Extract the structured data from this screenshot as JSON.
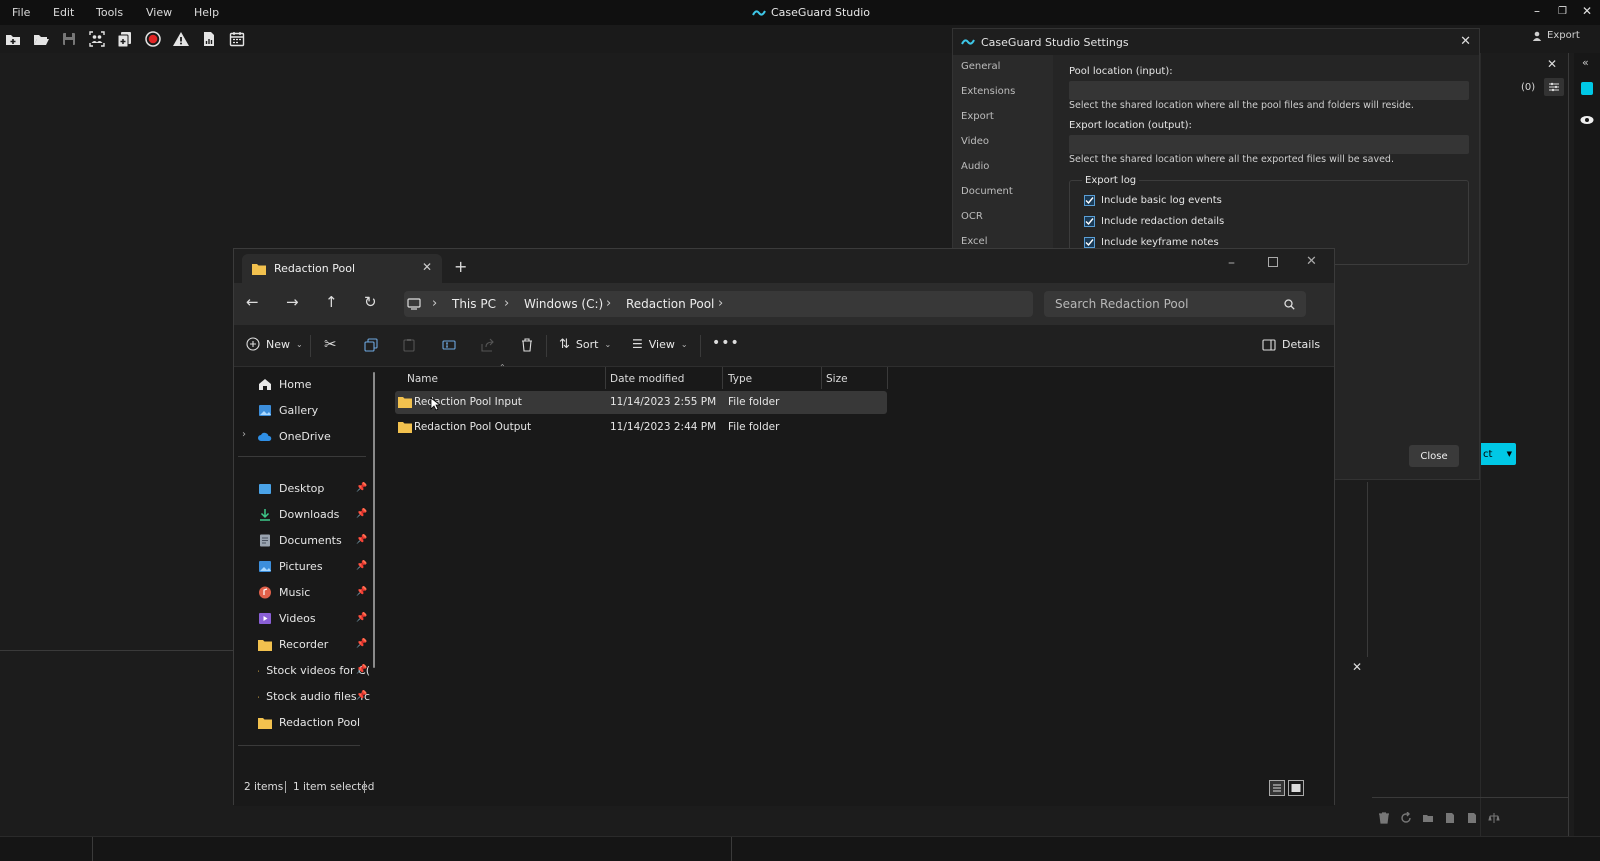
{
  "app": {
    "title": "CaseGuard Studio",
    "menu": [
      "File",
      "Edit",
      "Tools",
      "View",
      "Help"
    ],
    "export_label": "Export",
    "count_badge": "(0)",
    "close_icon_glyph": "✕",
    "partial_button_text": "ct",
    "panel_close_glyph": "✕"
  },
  "settings": {
    "title": "CaseGuard Studio Settings",
    "nav": [
      "General",
      "Extensions",
      "Export",
      "Video",
      "Audio",
      "Document",
      "OCR",
      "Excel"
    ],
    "pool_input_label": "Pool location (input):",
    "pool_input_value": "",
    "pool_input_desc": "Select the shared location where all the pool files and folders will reside.",
    "export_output_label": "Export location (output):",
    "export_output_value": "",
    "export_output_desc": "Select the shared location where all the exported files will be saved.",
    "export_log_legend": "Export log",
    "checkboxes": [
      {
        "label": "Include basic log events",
        "checked": true
      },
      {
        "label": "Include redaction details",
        "checked": true
      },
      {
        "label": "Include keyframe notes",
        "checked": true
      }
    ],
    "close_button": "Close"
  },
  "explorer": {
    "tab_title": "Redaction Pool",
    "breadcrumbs": [
      "This PC",
      "Windows (C:)",
      "Redaction Pool"
    ],
    "search_placeholder": "Search Redaction Pool",
    "commands": {
      "new": "New",
      "sort": "Sort",
      "view": "View",
      "details": "Details"
    },
    "nav_items": [
      {
        "label": "Home",
        "icon": "home-icon",
        "pinned": false
      },
      {
        "label": "Gallery",
        "icon": "gallery-icon",
        "pinned": false
      },
      {
        "label": "OneDrive",
        "icon": "cloud-icon",
        "pinned": false
      },
      {
        "label": "Desktop",
        "icon": "desktop-icon",
        "pinned": true
      },
      {
        "label": "Downloads",
        "icon": "download-icon",
        "pinned": true
      },
      {
        "label": "Documents",
        "icon": "document-icon",
        "pinned": true
      },
      {
        "label": "Pictures",
        "icon": "picture-icon",
        "pinned": true
      },
      {
        "label": "Music",
        "icon": "music-icon",
        "pinned": true
      },
      {
        "label": "Videos",
        "icon": "video-icon",
        "pinned": true
      },
      {
        "label": "Recorder",
        "icon": "folder-icon",
        "pinned": true
      },
      {
        "label": "Stock videos for C(",
        "icon": "folder-icon",
        "pinned": true
      },
      {
        "label": "Stock audio files fc",
        "icon": "folder-icon",
        "pinned": true
      },
      {
        "label": "Redaction Pool",
        "icon": "folder-icon",
        "pinned": false
      }
    ],
    "columns": [
      "Name",
      "Date modified",
      "Type",
      "Size"
    ],
    "files": [
      {
        "name": "Redaction Pool Input",
        "date": "11/14/2023 2:55 PM",
        "type": "File folder",
        "size": "",
        "selected": true
      },
      {
        "name": "Redaction Pool Output",
        "date": "11/14/2023 2:44 PM",
        "type": "File folder",
        "size": "",
        "selected": false
      }
    ],
    "status": {
      "count": "2 items",
      "selection": "1 item selected"
    }
  },
  "colors": {
    "accent": "#00c8e6",
    "folder": "#f2c14e",
    "selected_row": "#383838"
  }
}
